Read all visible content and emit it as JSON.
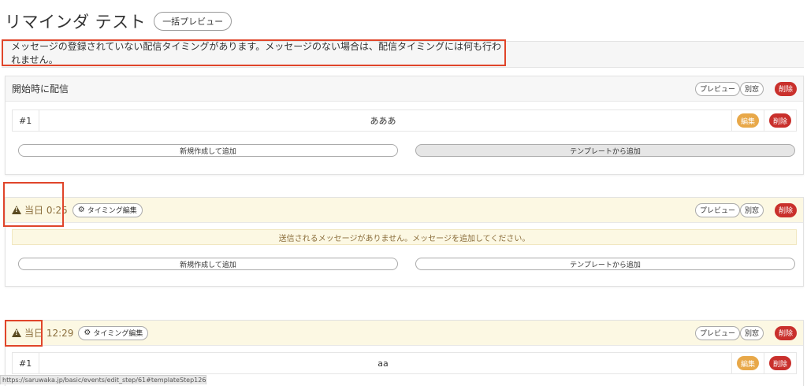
{
  "page": {
    "title": "リマインダ テスト",
    "bulk_preview": "一括プレビュー",
    "warning": "メッセージの登録されていない配信タイミングがあります。メッセージのない場合は、配信タイミングには何も行われません。"
  },
  "labels": {
    "preview": "プレビュー",
    "new_window": "別窓",
    "delete": "削除",
    "edit": "編集",
    "timing_edit": "タイミング編集",
    "add_new": "新規作成して追加",
    "add_template": "テンプレートから追加"
  },
  "sections": [
    {
      "title": "開始時に配信",
      "messages": [
        {
          "num": "#1",
          "text": "あああ"
        }
      ]
    },
    {
      "time": "当日 0:25",
      "empty_notice": "送信されるメッセージがありません。メッセージを追加してください。"
    },
    {
      "time": "当日 12:29",
      "messages": [
        {
          "num": "#1",
          "text": "aa"
        }
      ]
    }
  ],
  "status_url": "https://saruwaka.jp/basic/events/edit_step/61#templateStep126",
  "colors": {
    "warn_bg": "#fcf8e3",
    "danger": "#c9302c",
    "edit": "#e8a849",
    "highlight": "#e0452a"
  }
}
